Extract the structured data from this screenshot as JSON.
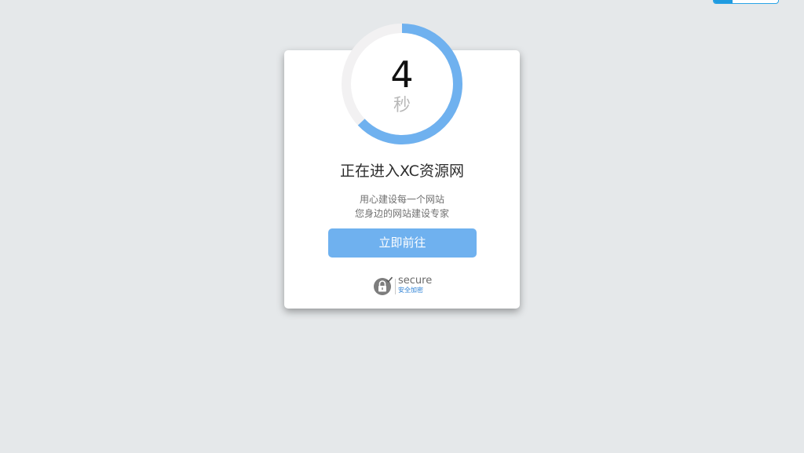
{
  "countdown": {
    "number": "4",
    "unit": "秒",
    "progress_fraction": 0.63,
    "progress_color": "#6fb1ef",
    "track_color": "#f2f1f2"
  },
  "title": "正在进入XC资源网",
  "subtitle_lines": [
    "用心建设每一个网站",
    "您身边的网站建设专家"
  ],
  "go_button": {
    "label": "立即前往",
    "color": "#6fb1ef"
  },
  "secure_badge": {
    "icon": "lock-check-icon",
    "word": "secure",
    "cn": "安全加密"
  },
  "colors": {
    "background": "#e5e8ea",
    "card": "#ffffff",
    "corner_accent": "#1f9be0"
  }
}
